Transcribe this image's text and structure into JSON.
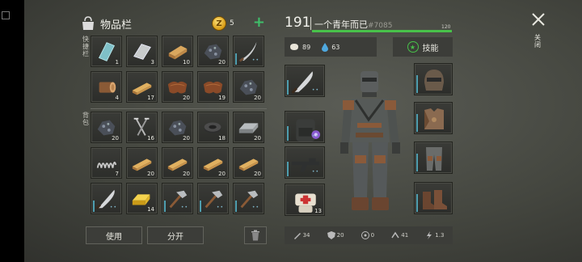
{
  "inventory": {
    "title": "物品栏",
    "coins": "5",
    "coin_glyph": "Z",
    "quick_label": "快捷栏",
    "pack_label": "背包",
    "quick_slots": [
      {
        "icon": "glass-pane-icon",
        "count": "1"
      },
      {
        "icon": "metal-sheet-icon",
        "count": "3"
      },
      {
        "icon": "wood-plank-icon",
        "count": "10"
      },
      {
        "icon": "ore-rock-icon",
        "count": "20"
      },
      {
        "icon": "curved-sword-icon",
        "count": ""
      },
      {
        "icon": "log-icon",
        "count": "4"
      },
      {
        "icon": "wood-board-icon",
        "count": "17"
      },
      {
        "icon": "leather-icon",
        "count": "20"
      },
      {
        "icon": "leather-icon",
        "count": "19"
      },
      {
        "icon": "ore-rock-icon",
        "count": "20"
      }
    ],
    "pack_slots": [
      {
        "icon": "ore-rock-icon",
        "count": "20"
      },
      {
        "icon": "nails-icon",
        "count": "16"
      },
      {
        "icon": "ore-rock-icon",
        "count": "20"
      },
      {
        "icon": "washer-icon",
        "count": "18"
      },
      {
        "icon": "steel-ingot-icon",
        "count": "20"
      },
      {
        "icon": "spring-icon",
        "count": "7"
      },
      {
        "icon": "wood-board-icon",
        "count": "20"
      },
      {
        "icon": "wood-board-icon",
        "count": "20"
      },
      {
        "icon": "wood-board-icon",
        "count": "20"
      },
      {
        "icon": "wood-board-icon",
        "count": "20"
      },
      {
        "icon": "machete-icon",
        "count": ""
      },
      {
        "icon": "gold-ingot-icon",
        "count": "14"
      },
      {
        "icon": "hammer-icon",
        "count": ""
      },
      {
        "icon": "hammer-icon",
        "count": ""
      },
      {
        "icon": "hammer-icon",
        "count": ""
      }
    ],
    "use_label": "使用",
    "split_label": "分开"
  },
  "character": {
    "level": "191",
    "name": "一个青年而已",
    "id": "#7085",
    "hp_max": "120",
    "hp_fraction": 1.0,
    "food": "89",
    "water": "63",
    "skill_label": "技能",
    "hand_slots": [
      {
        "icon": "machete-icon",
        "count": ""
      },
      {
        "icon": "backpack-icon",
        "count": ""
      },
      {
        "icon": "rifle-icon",
        "count": ""
      },
      {
        "icon": "bandage-icon",
        "count": "13"
      }
    ],
    "armor_slots": [
      {
        "icon": "helmet-icon"
      },
      {
        "icon": "chest-armor-icon"
      },
      {
        "icon": "leg-armor-icon"
      },
      {
        "icon": "boots-icon"
      }
    ],
    "stats": [
      {
        "icon": "sword-icon",
        "value": "34"
      },
      {
        "icon": "shield-icon",
        "value": "20"
      },
      {
        "icon": "radiation-icon",
        "value": "0"
      },
      {
        "icon": "speed-icon",
        "value": "41"
      },
      {
        "icon": "lightning-icon",
        "value": "1.3"
      }
    ]
  },
  "close_label": "关闭",
  "colors": {
    "hp": "#48c24a",
    "accent": "#3fbf6a",
    "gold": "#d79b14"
  }
}
